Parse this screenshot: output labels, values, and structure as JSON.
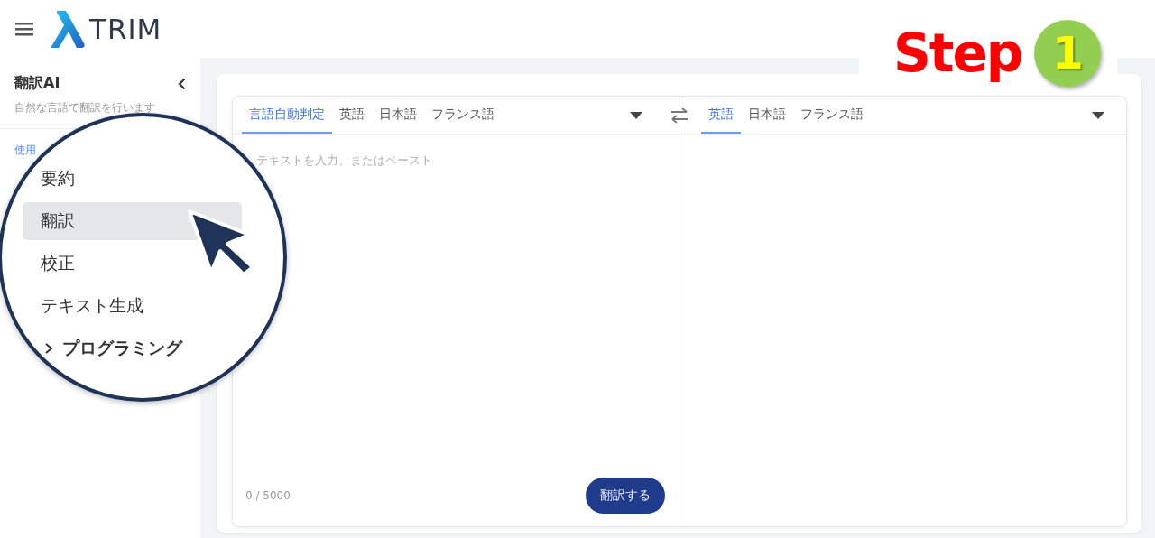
{
  "header": {
    "logo_text": "TRIM"
  },
  "sidebar": {
    "title": "翻訳AI",
    "subtitle": "自然な言語で翻訳を行います",
    "link": "使用"
  },
  "source": {
    "tabs": [
      {
        "label": "言語自動判定",
        "selected": true
      },
      {
        "label": "英語",
        "selected": false
      },
      {
        "label": "日本語",
        "selected": false
      },
      {
        "label": "フランス語",
        "selected": false
      }
    ],
    "placeholder": "テキストを入力、またはペースト",
    "counter": "0 / 5000",
    "button": "翻訳する"
  },
  "target": {
    "tabs": [
      {
        "label": "英語",
        "selected": true
      },
      {
        "label": "日本語",
        "selected": false
      },
      {
        "label": "フランス語",
        "selected": false
      }
    ]
  },
  "magnifier": {
    "items": [
      {
        "kind": "item",
        "label": "要約",
        "selected": false
      },
      {
        "kind": "item",
        "label": "翻訳",
        "selected": true
      },
      {
        "kind": "item",
        "label": "校正",
        "selected": false
      },
      {
        "kind": "item",
        "label": "テキスト生成",
        "selected": false
      },
      {
        "kind": "group",
        "label": "プログラミング",
        "selected": false,
        "expanded": false
      }
    ]
  },
  "step": {
    "label": "Step",
    "number": "1"
  }
}
